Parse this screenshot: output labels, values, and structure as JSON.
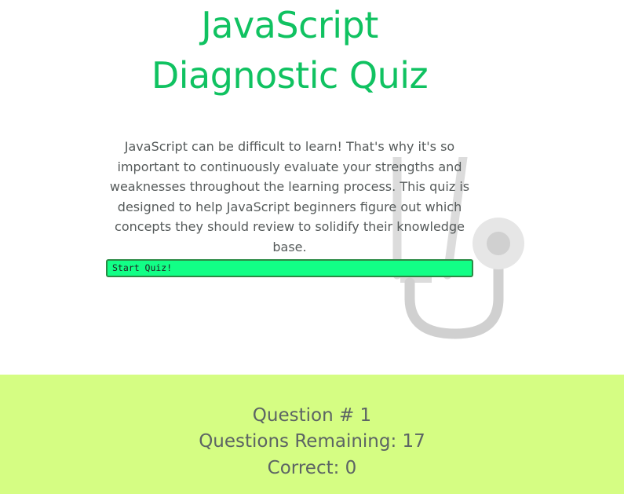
{
  "hero": {
    "title": "JavaScript Diagnostic Quiz",
    "intro": "JavaScript can be difficult to learn! That's why it's so important to continuously evaluate your strengths and weaknesses throughout the learning process. This quiz is designed to help JavaScript beginners figure out which concepts they should review to solidify their knowledge base.",
    "start_button": "Start Quiz!",
    "illustration_icon": "stethoscope-icon"
  },
  "status": {
    "question_number": "Question # 1",
    "questions_remaining": "Questions Remaining: 17",
    "correct": "Correct: 0"
  },
  "colors": {
    "title": "#10c261",
    "button_bg": "#12ff86",
    "status_bg": "#d5fd83",
    "text": "#555a5a"
  }
}
